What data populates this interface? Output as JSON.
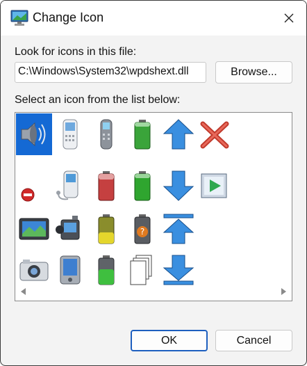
{
  "window": {
    "title": "Change Icon",
    "close_icon": "close-icon"
  },
  "file_section": {
    "label": "Look for icons in this file:",
    "path_value": "C:\\Windows\\System32\\wpdshext.dll",
    "browse_label": "Browse..."
  },
  "icon_list": {
    "label": "Select an icon from the list below:",
    "selected_index": 0,
    "icons": [
      "speaker-icon",
      "blue-up-arrow-icon",
      "generic-device-icon",
      "multi-document-icon",
      "white-mobile-phone-icon",
      "red-x-icon",
      "music-phone-icon",
      "blue-down-arrow-icon",
      "gray-mobile-phone-icon",
      "camera-icon",
      "red-battery-icon",
      "upload-to-top-icon",
      "green-battery-icon",
      "yellow-battery-icon",
      "green-battery-small-icon",
      "download-arrow-icon",
      "media-player-icon",
      "unknown-battery-icon",
      "video-camera-icon",
      "pda-icon",
      "green-battery-tall-icon",
      "stop-sign-icon",
      "handheld-device-icon",
      "play-media-icon"
    ]
  },
  "buttons": {
    "ok_label": "OK",
    "cancel_label": "Cancel"
  }
}
